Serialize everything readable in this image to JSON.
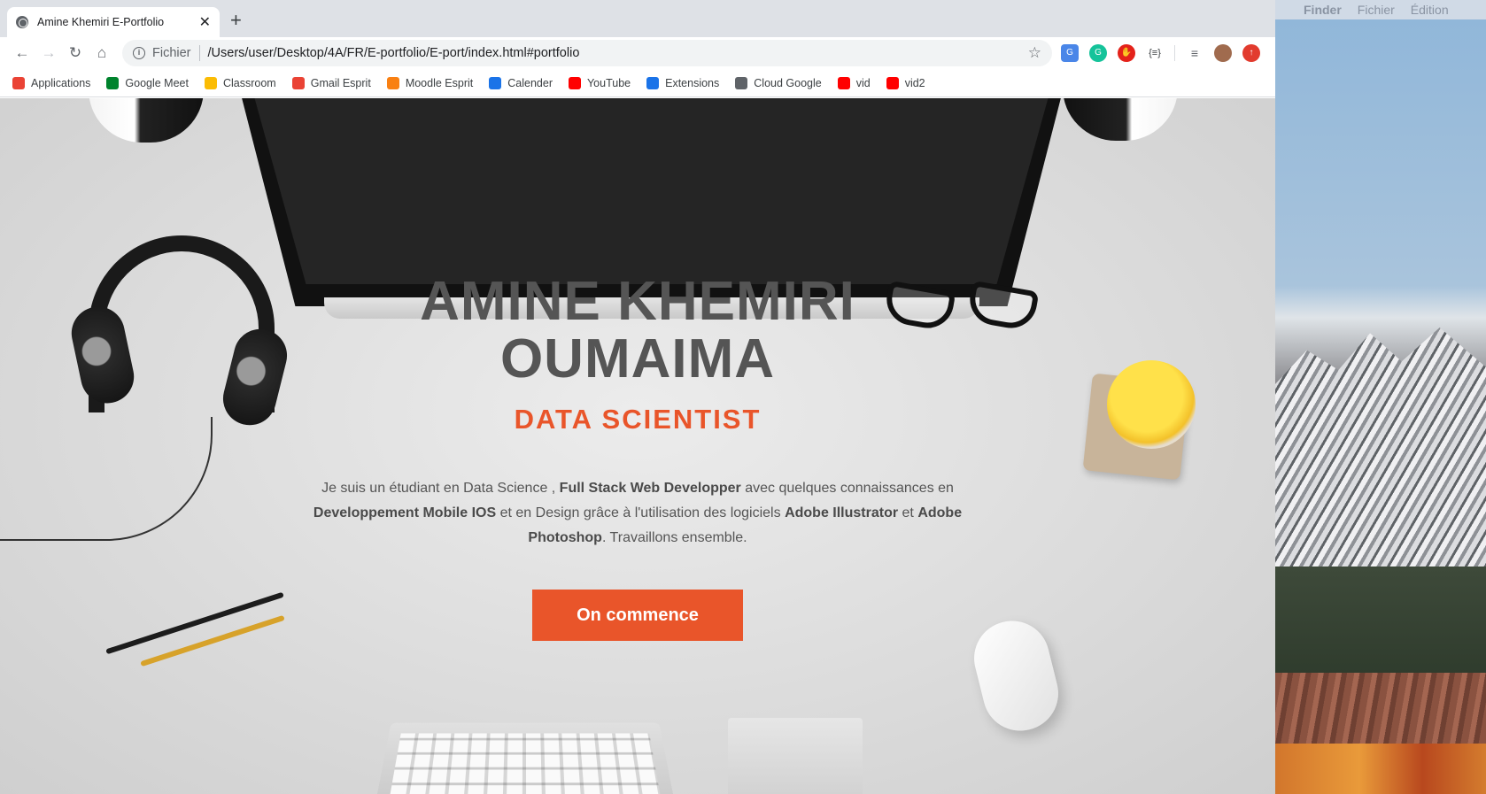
{
  "browser": {
    "tab": {
      "title": "Amine Khemiri E-Portfolio",
      "close_glyph": "✕"
    },
    "new_tab_glyph": "+",
    "toolbar": {
      "back_glyph": "←",
      "forward_glyph": "→",
      "reload_glyph": "↻",
      "home_glyph": "⌂",
      "info_glyph": "i",
      "scheme": "Fichier",
      "url": "/Users/user/Desktop/4A/FR/E-portfolio/E-port/index.html#portfolio",
      "star_glyph": "☆"
    },
    "extensions": {
      "translate": "G",
      "grammarly": "G",
      "adblock": "✋",
      "json": "{≡}",
      "media": "≡",
      "profile": "",
      "update": "↑"
    },
    "bookmarks": [
      {
        "label": "Applications",
        "icon": "apps-grid-icon",
        "color": "#ea4335"
      },
      {
        "label": "Google Meet",
        "icon": "meet-icon",
        "color": "#00832d"
      },
      {
        "label": "Classroom",
        "icon": "classroom-icon",
        "color": "#fbbc04"
      },
      {
        "label": "Gmail Esprit",
        "icon": "gmail-icon",
        "color": "#ea4335"
      },
      {
        "label": "Moodle Esprit",
        "icon": "moodle-icon",
        "color": "#f98012"
      },
      {
        "label": "Calender",
        "icon": "calendar-icon",
        "color": "#1a73e8"
      },
      {
        "label": "YouTube",
        "icon": "youtube-icon",
        "color": "#ff0000"
      },
      {
        "label": "Extensions",
        "icon": "puzzle-icon",
        "color": "#1a73e8"
      },
      {
        "label": "Cloud Google",
        "icon": "cloud-icon",
        "color": "#5f6368"
      },
      {
        "label": "vid",
        "icon": "youtube-icon",
        "color": "#ff0000"
      },
      {
        "label": "vid2",
        "icon": "youtube-icon",
        "color": "#ff0000"
      }
    ]
  },
  "hero": {
    "name_line1": "AMINE KHEMIRI",
    "name_line2": "OUMAIMA",
    "role": "DATA SCIENTIST",
    "bio_parts": {
      "p1": "Je suis un étudiant en Data Science , ",
      "b1": "Full Stack Web Developper",
      "p2": " avec quelques connaissances en ",
      "b2": "Developpement Mobile IOS",
      "p3": " et en Design grâce à l'utilisation des logiciels ",
      "b3": "Adobe Illustrator",
      "p4": " et ",
      "b4": "Adobe Photoshop",
      "p5": ". Travaillons ensemble."
    },
    "cta_label": "On commence"
  },
  "mac": {
    "apple_glyph": "",
    "menu": [
      "Finder",
      "Fichier",
      "Édition"
    ]
  },
  "colors": {
    "accent": "#e9552a",
    "heading": "#555555"
  }
}
